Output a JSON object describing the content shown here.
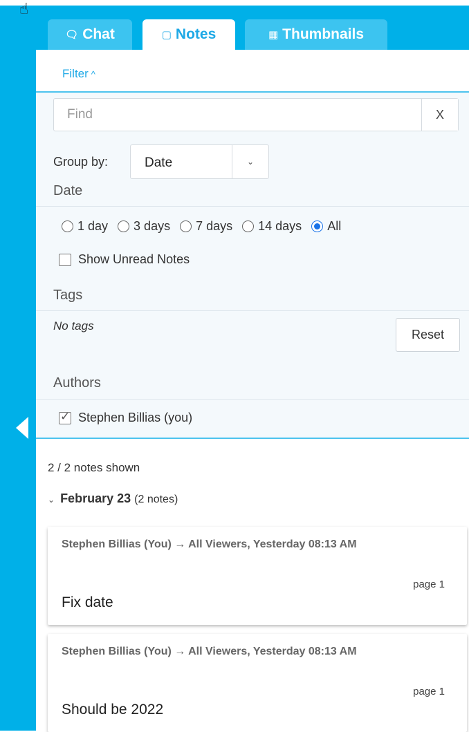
{
  "tabs": [
    {
      "label": "Chat",
      "icon": "chat-icon",
      "active": false
    },
    {
      "label": "Notes",
      "icon": "note-icon",
      "active": true
    },
    {
      "label": "Thumbnails",
      "icon": "grid-icon",
      "active": false
    }
  ],
  "filter": {
    "toggle_label": "Filter",
    "find_placeholder": "Find",
    "find_value": "",
    "clear_label": "X",
    "group_by_label": "Group by:",
    "group_by_value": "Date",
    "date_title": "Date",
    "date_options": [
      "1 day",
      "3 days",
      "7 days",
      "14 days",
      "All"
    ],
    "date_selected": "All",
    "show_unread_label": "Show Unread Notes",
    "show_unread_checked": false,
    "tags_title": "Tags",
    "no_tags_text": "No tags",
    "reset_label": "Reset",
    "authors_title": "Authors",
    "author_name": "Stephen Billias (you)",
    "author_checked": true
  },
  "notes_list": {
    "count_text": "2 / 2 notes shown",
    "group_title": "February 23",
    "group_count": "(2 notes)",
    "notes": [
      {
        "meta": "Stephen Billias (You) → All Viewers, Yesterday 08:13 AM",
        "page": "page 1",
        "text": "Fix date"
      },
      {
        "meta": "Stephen Billias (You) → All Viewers, Yesterday 08:13 AM",
        "page": "page 1",
        "text": "Should be 2022"
      }
    ]
  },
  "colors": {
    "accent": "#00b0e8",
    "link": "#1fa9e6",
    "radio_selected": "#1a73e8"
  }
}
